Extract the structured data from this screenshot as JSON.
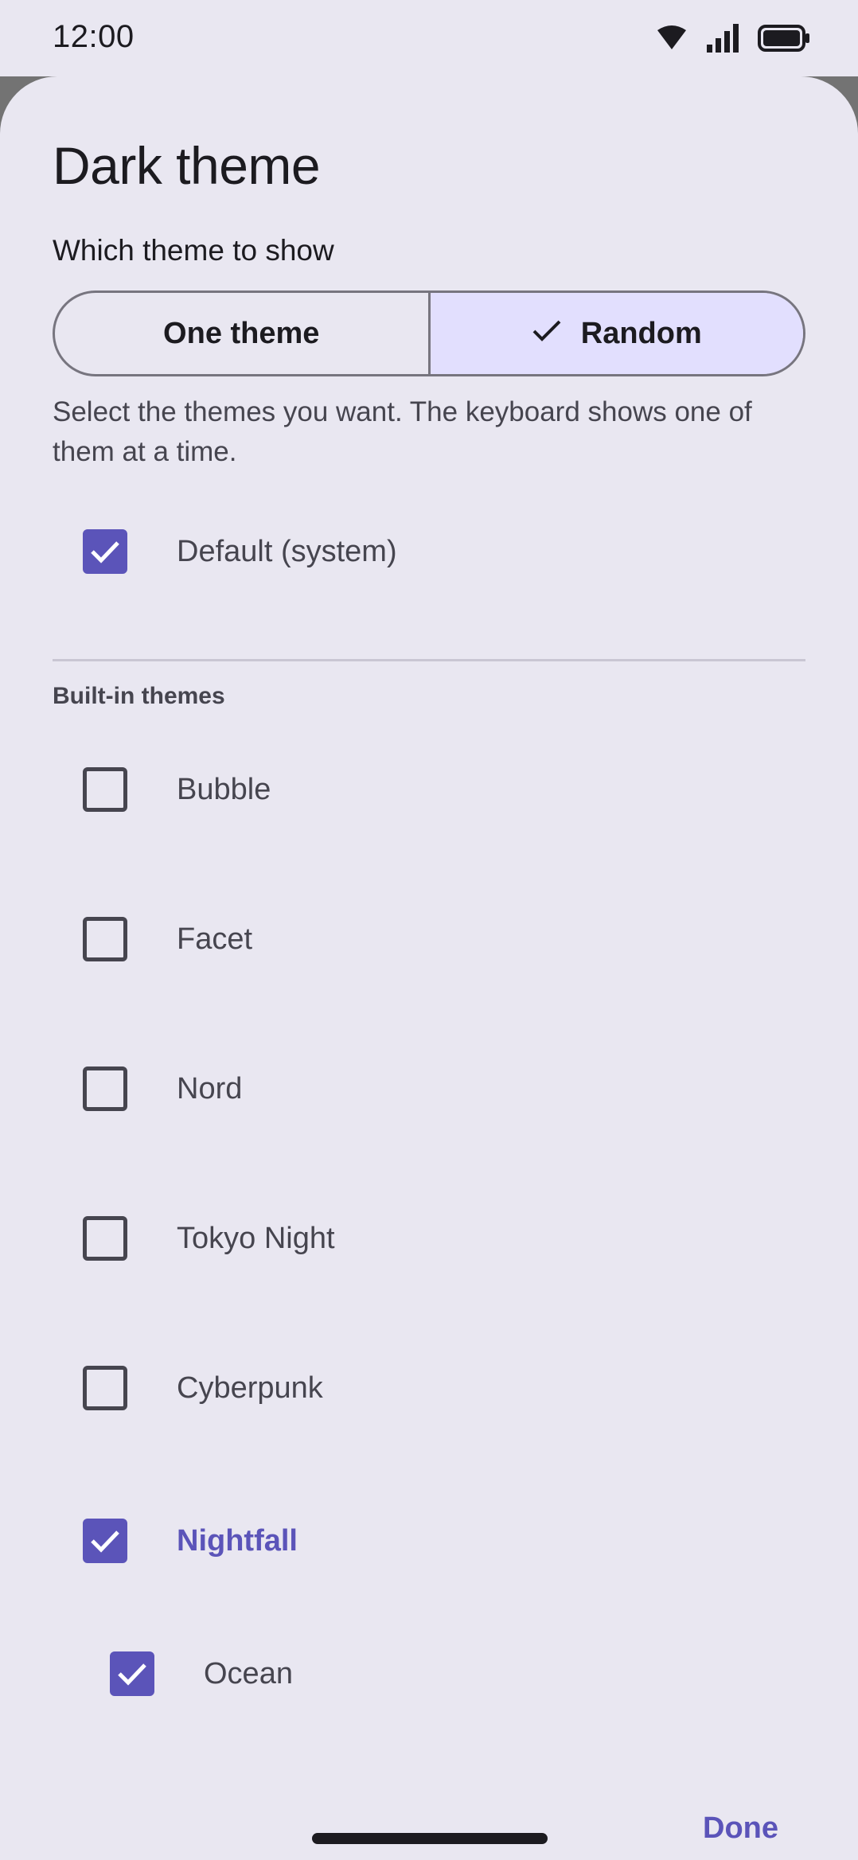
{
  "status_bar": {
    "time": "12:00",
    "icons": [
      "wifi-icon",
      "signal-icon",
      "battery-icon"
    ]
  },
  "sheet": {
    "title": "Dark theme",
    "subtitle": "Which theme to show",
    "mode_toggle": {
      "options": [
        {
          "label": "One theme",
          "selected": false
        },
        {
          "label": "Random",
          "selected": true,
          "icon": "check-icon"
        }
      ]
    },
    "description": "Select the themes you want. The keyboard shows one of them at a time.",
    "default_option": {
      "label": "Default (system)",
      "checked": true
    },
    "section_header": "Built-in themes",
    "themes": [
      {
        "label": "Bubble",
        "checked": false
      },
      {
        "label": "Facet",
        "checked": false
      },
      {
        "label": "Nord",
        "checked": false
      },
      {
        "label": "Tokyo Night",
        "checked": false
      },
      {
        "label": "Cyberpunk",
        "checked": false
      },
      {
        "label": "Nightfall",
        "checked": true
      },
      {
        "label": "Ocean",
        "checked": true
      }
    ],
    "done_label": "Done"
  },
  "colors": {
    "background": "#e9e7f1",
    "accent": "#5b54b9",
    "selected_segment": "#e2dffe",
    "text_primary": "#1c1b20",
    "text_secondary": "#46454f"
  }
}
